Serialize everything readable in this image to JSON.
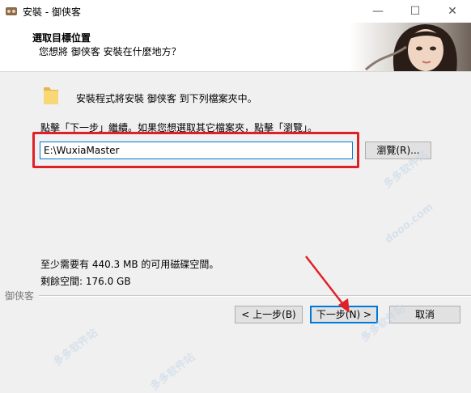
{
  "window": {
    "title": "安裝 - 御侠客",
    "minimize_glyph": "—",
    "maximize_glyph": "☐",
    "close_glyph": "✕"
  },
  "header": {
    "title": "選取目標位置",
    "subtitle": "您想將 御侠客 安裝在什麼地方？",
    "image_icon": "character-portrait"
  },
  "main": {
    "folder_icon": "folder-icon",
    "intro": "安裝程式將安裝 御侠客 到下列檔案夾中。",
    "instruction": "點擊「下一步」繼續。如果您想選取其它檔案夾，點擊「瀏覽」。",
    "path_value": "E:\\WuxiaMaster",
    "browse_label": "瀏覽(R)...",
    "space_required": "至少需要有 440.3 MB 的可用磁碟空間。",
    "space_free": "剩餘空間: 176.0 GB"
  },
  "footer": {
    "brand": "御侠客",
    "back_label": "< 上一步(B)",
    "next_label": "下一步(N) >",
    "cancel_label": "取消"
  },
  "annotations": {
    "highlight_color": "#e02028"
  },
  "watermarks": [
    "多多软件站",
    "dooo.com",
    "多多软件站",
    "多多软件站",
    "多多软件站"
  ]
}
